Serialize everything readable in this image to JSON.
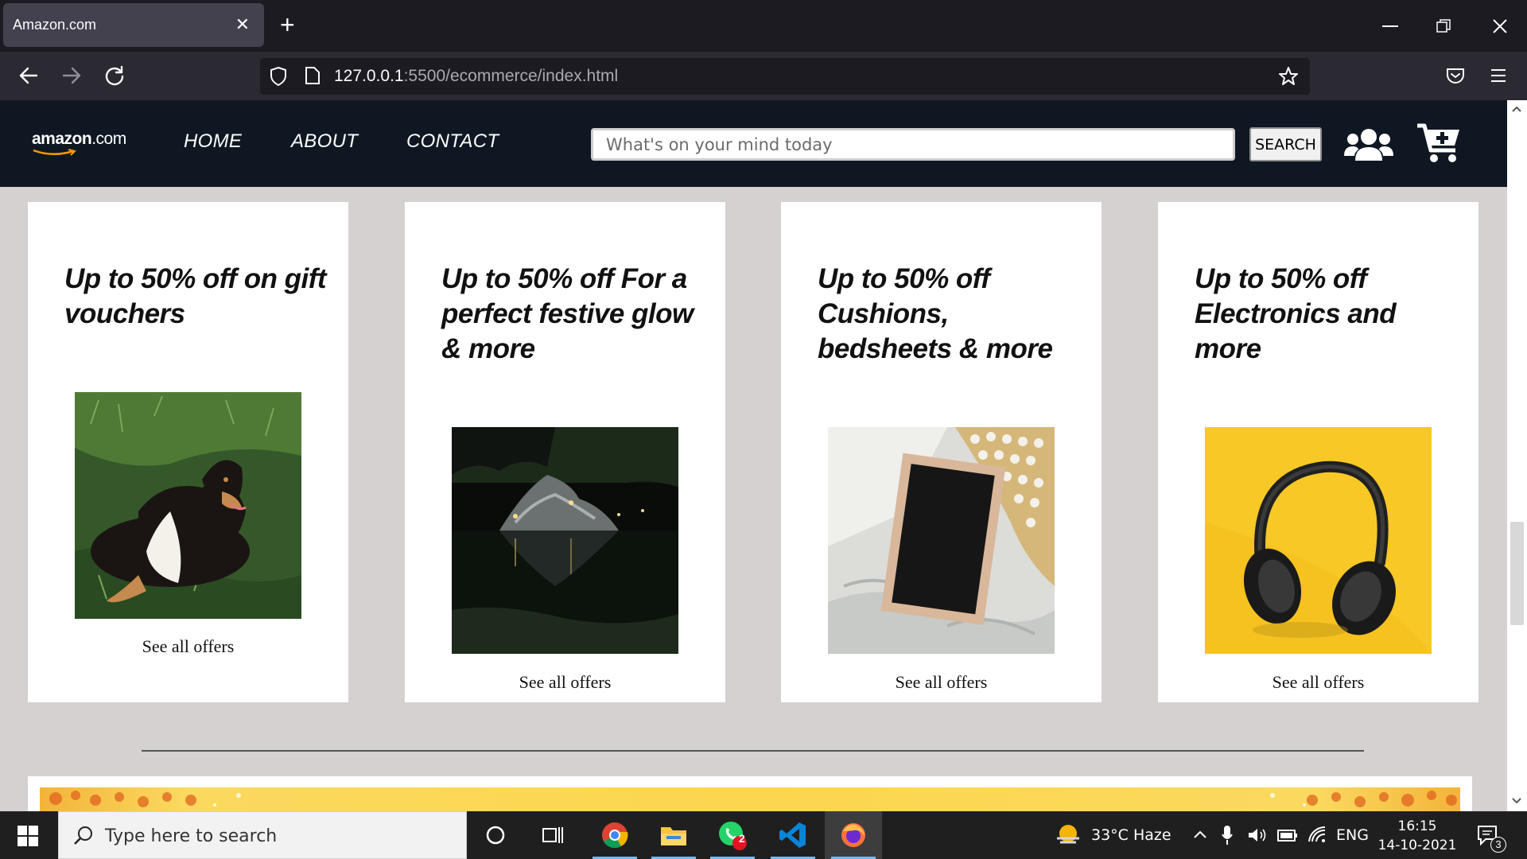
{
  "browser": {
    "tab_title": "Amazon.com",
    "tab_close": "✕",
    "new_tab": "+",
    "url_host": "127.0.0.1",
    "url_path": ":5500/ecommerce/index.html"
  },
  "header": {
    "logo_text": "amazon",
    "logo_suffix": ".com",
    "nav": [
      "HOME",
      "ABOUT",
      "CONTACT"
    ],
    "search_placeholder": "What's on your mind today",
    "search_button": "SEARCH"
  },
  "cards": [
    {
      "title": "Up to 50% off on gift vouchers",
      "link": "See all offers",
      "image": "dog-on-grass"
    },
    {
      "title": "Up to 50% off For a perfect festive glow & more",
      "link": "See all offers",
      "image": "lit-rock-pond-at-night"
    },
    {
      "title": "Up to 50% off Cushions, bedsheets & more",
      "link": "See all offers",
      "image": "letterboard-on-cushions"
    },
    {
      "title": "Up to 50% off Electronics and more",
      "link": "See all offers",
      "image": "headphones-on-yellow"
    }
  ],
  "taskbar": {
    "search_placeholder": "Type here to search",
    "whatsapp_badge": "2",
    "weather": "33°C  Haze",
    "language": "ENG",
    "time": "16:15",
    "date": "14-10-2021",
    "notifications": "3"
  },
  "colors": {
    "site_header": "#0f1822",
    "page_bg": "#d6d1d1",
    "card_bg": "#ffffff",
    "browser_toolbar": "#2b2a33"
  }
}
